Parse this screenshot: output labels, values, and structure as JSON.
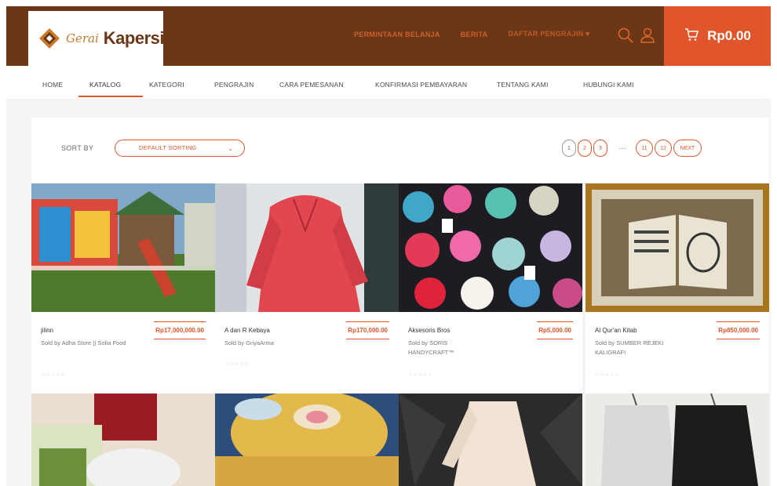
{
  "brand": {
    "script": "Gerai",
    "name": "Kapersi"
  },
  "top_links": [
    "PERMINTAAN BELANJA",
    "BERITA",
    "DAFTAR PENGRAJIN"
  ],
  "cart": {
    "amount": "Rp0.00"
  },
  "nav": [
    "HOME",
    "KATALOG",
    "KATEGORI",
    "PENGRAJIN",
    "CARA PEMESANAN",
    "KONFIRMASI PEMBAYARAN",
    "TENTANG KAMI",
    "HUBUNGI KAMI"
  ],
  "sort": {
    "label": "SORT BY",
    "value": "DEFAULT SORTING"
  },
  "pagination": {
    "pages": [
      "1",
      "2",
      "3"
    ],
    "dots": "…",
    "last": [
      "11",
      "12"
    ],
    "next": "NEXT"
  },
  "products": [
    {
      "name": "jilinn",
      "seller": "Sold by Adha Store || Sofia Food",
      "price": "Rp17,000,000.00",
      "rating": "☆☆☆☆☆"
    },
    {
      "name": "A dan R Kebaya",
      "seller": "Sold by GriyaArma",
      "price": "Rp170,000.00",
      "rating": "☆☆☆☆☆"
    },
    {
      "name": "Aksesoris Bros",
      "seller": "Sold by SORIS HANDYCRAFT™",
      "price": "Rp5,000.00",
      "rating": "☆☆☆☆☆"
    },
    {
      "name": "Al Qur'an Kitab",
      "seller": "Sold by SUMBER REJEKI KALIGRAFI",
      "price": "Rp850,000.00",
      "rating": "☆☆☆☆☆"
    }
  ],
  "colors": {
    "header_brown": "#6b3716",
    "accent_orange": "#e1552a"
  }
}
